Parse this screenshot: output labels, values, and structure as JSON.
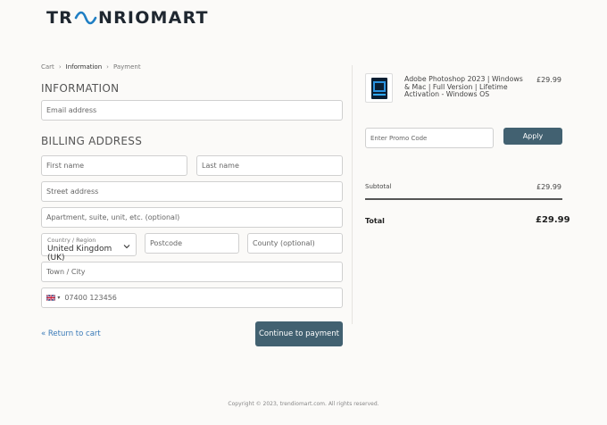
{
  "logo": {
    "text_left": "TR",
    "text_right": "NRIOMART",
    "wave_icon": "wave-logo-icon"
  },
  "breadcrumb": {
    "items": [
      "Cart",
      "Information",
      "Payment"
    ],
    "separator": "›",
    "current_index": 1
  },
  "information": {
    "title": "INFORMATION",
    "email_placeholder": "Email address"
  },
  "billing": {
    "title": "BILLING ADDRESS",
    "first_name_placeholder": "First name",
    "last_name_placeholder": "Last name",
    "street_placeholder": "Street address",
    "apartment_placeholder": "Apartment, suite, unit, etc. (optional)",
    "country_label": "Country / Region",
    "country_value": "United Kingdom (UK)",
    "postcode_placeholder": "Postcode",
    "county_placeholder": "County (optional)",
    "town_placeholder": "Town / City",
    "phone_placeholder": "07400 123456",
    "phone_country_icon": "uk-flag-icon"
  },
  "actions": {
    "return_label": "« Return to cart",
    "continue_label": "Continue to payment"
  },
  "order": {
    "product_title": "Adobe Photoshop 2023 | Windows & Mac | Full Version | Lifetime Activation - Windows OS",
    "product_price": "£29.99",
    "promo_placeholder": "Enter Promo Code",
    "apply_label": "Apply",
    "subtotal_label": "Subtotal",
    "subtotal_value": "£29.99",
    "total_label": "Total",
    "total_value": "£29.99"
  },
  "footer": {
    "copyright": "Copyright © 2023, trendiomart.com. All rights reserved."
  },
  "colors": {
    "background": "#fbfaf8",
    "primary_button": "#426171",
    "link": "#3a7ab8",
    "logo_wave": "#1f7fc4"
  }
}
